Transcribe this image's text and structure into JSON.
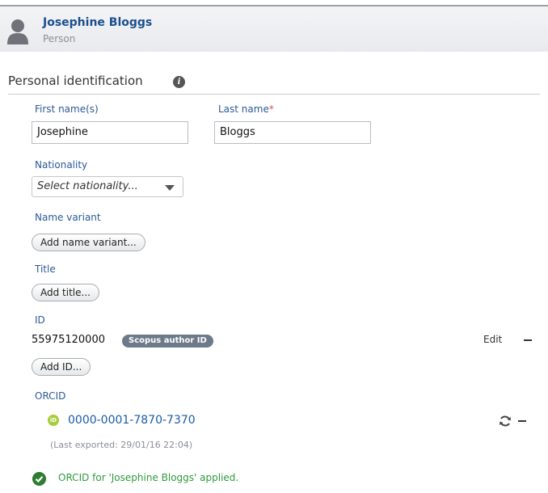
{
  "header": {
    "name": "Josephine Bloggs",
    "role": "Person"
  },
  "section": {
    "title": "Personal identification"
  },
  "form": {
    "first_name_label": "First name(s)",
    "first_name_value": "Josephine",
    "last_name_label": "Last name",
    "last_name_required_mark": "*",
    "last_name_value": "Bloggs",
    "nationality_label": "Nationality",
    "nationality_placeholder": "Select nationality...",
    "name_variant_label": "Name variant",
    "add_name_variant_button": "Add name variant...",
    "title_label": "Title",
    "add_title_button": "Add title..."
  },
  "ids": {
    "label": "ID",
    "value": "55975120000",
    "badge": "Scopus author ID",
    "edit_label": "Edit",
    "add_id_button": "Add ID..."
  },
  "orcid": {
    "label": "ORCID",
    "icon_text": "iD",
    "value": "0000-0001-7870-7370",
    "last_exported": "(Last exported: 29/01/16 22:04)",
    "success_message": "ORCID for 'Josephine Bloggs' applied.",
    "brand_color": "#a6ce39"
  },
  "icons": {
    "avatar": "person-icon",
    "info": "info-icon",
    "select_caret": "chevron-down-icon",
    "refresh": "refresh-icon",
    "remove": "minus-icon",
    "success": "check-circle-icon"
  }
}
